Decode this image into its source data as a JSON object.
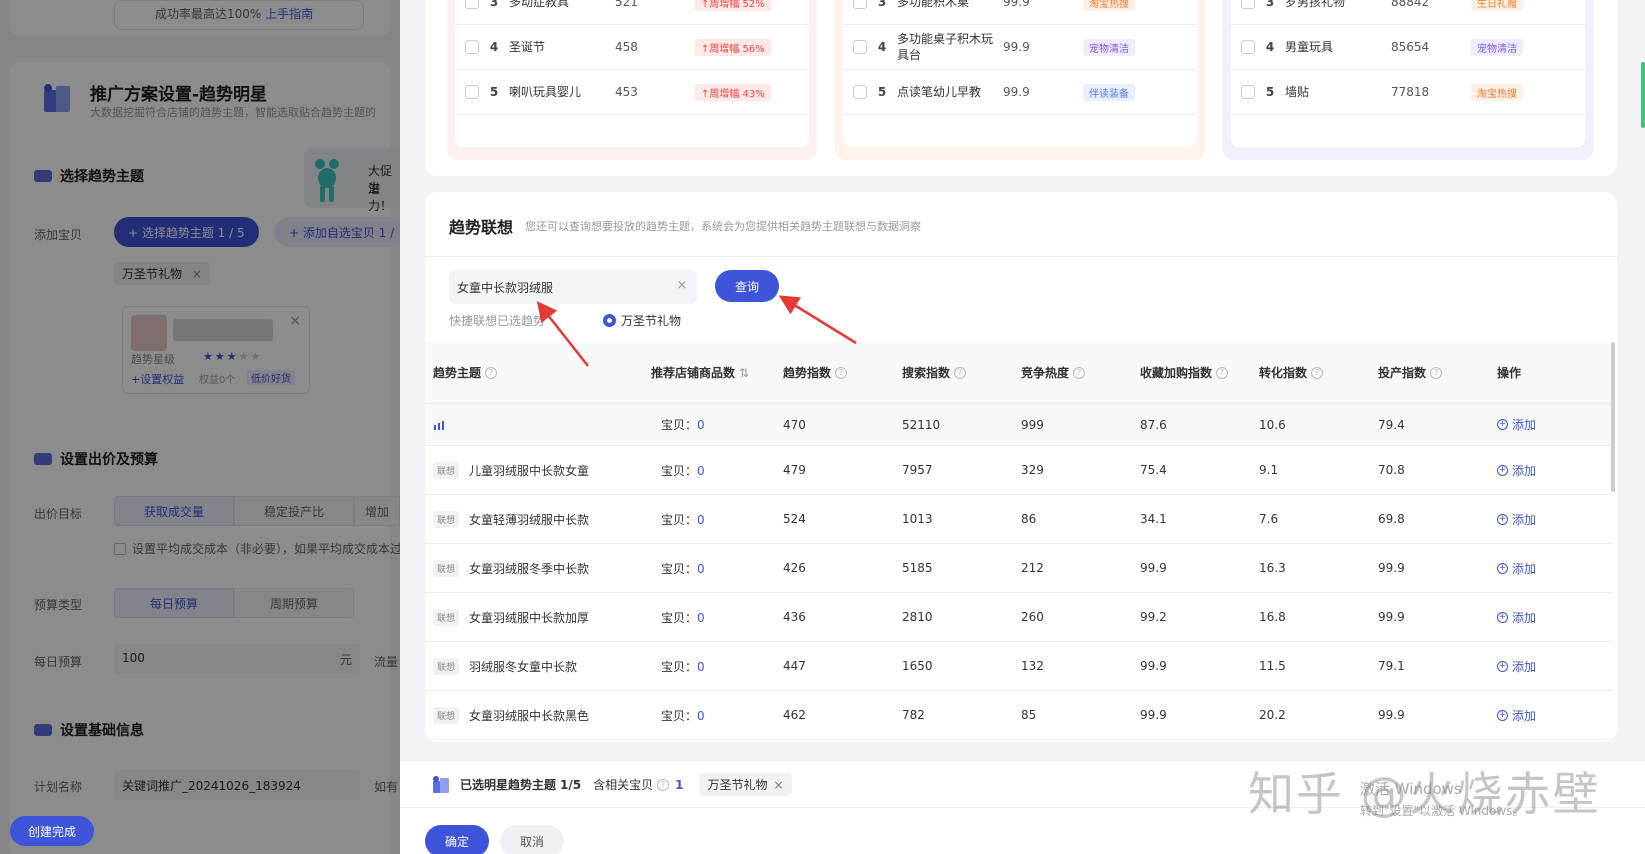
{
  "left_panel": {
    "top_hint": "成功率最高达100%",
    "top_hint_link": "上手指南",
    "title": "推广方案设置-趋势明星",
    "subtitle": "大数据挖掘符合店铺的趋势主题，智能选取贴合趋势主题的",
    "section_trend": "选择趋势主题",
    "promo_text_1": "大促生",
    "promo_text_2": "潜力！",
    "add_item_label": "添加宝贝",
    "select_trend_btn": "+ 选择趋势主题 1 / 5",
    "add_self_btn": "+ 添加自选宝贝 1 /",
    "selected_chip": "万圣节礼物",
    "item_star_label": "趋势星级",
    "item_set_rights": "+设置权益",
    "item_rights_text": "权益0个",
    "item_low_price": "低价好货",
    "section_bid": "设置出价及预算",
    "bid_target_label": "出价目标",
    "bid_opt_1": "获取成交量",
    "bid_opt_2": "稳定投产比",
    "bid_opt_3": "增加",
    "bid_checkbox_text": "设置平均成交成本（非必要），如果平均成交成本过",
    "budget_type_label": "预算类型",
    "budget_opt_1": "每日预算",
    "budget_opt_2": "周期预算",
    "daily_budget_label": "每日预算",
    "daily_budget_value": "100",
    "daily_budget_unit": "元",
    "flow_label": "流量",
    "section_basic": "设置基础信息",
    "plan_name_label": "计划名称",
    "plan_name_value": "关键词推广_20241026_183924",
    "plan_name_extra": "如有",
    "create_done": "创建完成"
  },
  "rank_lists": [
    {
      "rows": [
        {
          "no": "3",
          "name": "多动症教具",
          "value": "521",
          "tag": "↑周增幅 52%",
          "tag_color": "red"
        },
        {
          "no": "4",
          "name": "圣诞节",
          "value": "458",
          "tag": "↑周增幅 56%",
          "tag_color": "red"
        },
        {
          "no": "5",
          "name": "喇叭玩具婴儿",
          "value": "453",
          "tag": "↑周增幅 43%",
          "tag_color": "red"
        }
      ]
    },
    {
      "rows": [
        {
          "no": "3",
          "name": "多功能积木桌",
          "value": "99.9",
          "tag": "淘宝热搜",
          "tag_color": "orange"
        },
        {
          "no": "4",
          "name": "多功能桌子积木玩具台",
          "value": "99.9",
          "tag": "宠物清洁",
          "tag_color": "purple"
        },
        {
          "no": "5",
          "name": "点读笔幼儿早教",
          "value": "99.9",
          "tag": "伴读装备",
          "tag_color": "blue"
        }
      ]
    },
    {
      "rows": [
        {
          "no": "3",
          "name": "岁男孩礼物",
          "value": "88842",
          "tag": "生日礼赠",
          "tag_color": "orange"
        },
        {
          "no": "4",
          "name": "男童玩具",
          "value": "85654",
          "tag": "宠物清洁",
          "tag_color": "purple"
        },
        {
          "no": "5",
          "name": "墙贴",
          "value": "77818",
          "tag": "淘宝热搜",
          "tag_color": "orange"
        }
      ]
    }
  ],
  "assoc": {
    "title": "趋势联想",
    "desc": "您还可以查询想要投放的趋势主题，系统会为您提供相关趋势主题联想与数据洞察",
    "search_value": "女童中长款羽绒服",
    "clear": "×",
    "query_btn": "查询",
    "quick_label": "快捷联想已选趋势",
    "quick_option": "万圣节礼物"
  },
  "table": {
    "headers": [
      "趋势主题",
      "推荐店铺商品数",
      "趋势指数",
      "搜索指数",
      "竞争热度",
      "收藏加购指数",
      "转化指数",
      "投产指数",
      "操作"
    ],
    "sort_icon": "⇅",
    "goods_prefix": "宝贝：",
    "assoc_tag": "联想",
    "add_label": "添加",
    "rows": [
      {
        "theme": "",
        "goods": "0",
        "trend": "470",
        "search": "52110",
        "compete": "999",
        "fav": "87.6",
        "conv": "10.6",
        "roi": "79.4"
      },
      {
        "theme": "儿童羽绒服中长款女童",
        "goods": "0",
        "trend": "479",
        "search": "7957",
        "compete": "329",
        "fav": "75.4",
        "conv": "9.1",
        "roi": "70.8"
      },
      {
        "theme": "女童轻薄羽绒服中长款",
        "goods": "0",
        "trend": "524",
        "search": "1013",
        "compete": "86",
        "fav": "34.1",
        "conv": "7.6",
        "roi": "69.8"
      },
      {
        "theme": "女童羽绒服冬季中长款",
        "goods": "0",
        "trend": "426",
        "search": "5185",
        "compete": "212",
        "fav": "99.9",
        "conv": "16.3",
        "roi": "99.9"
      },
      {
        "theme": "女童羽绒服中长款加厚",
        "goods": "0",
        "trend": "436",
        "search": "2810",
        "compete": "260",
        "fav": "99.2",
        "conv": "16.8",
        "roi": "99.9"
      },
      {
        "theme": "羽绒服冬女童中长款",
        "goods": "0",
        "trend": "447",
        "search": "1650",
        "compete": "132",
        "fav": "99.9",
        "conv": "11.5",
        "roi": "79.1"
      },
      {
        "theme": "女童羽绒服中长款黑色",
        "goods": "0",
        "trend": "462",
        "search": "782",
        "compete": "85",
        "fav": "99.9",
        "conv": "20.2",
        "roi": "99.9"
      }
    ]
  },
  "footer": {
    "selected_label": "已选明星趋势主题",
    "selected_count": "1/5",
    "goods_label": "含相关宝贝",
    "goods_count": "1",
    "chip": "万圣节礼物",
    "ok": "确定",
    "cancel": "取消"
  },
  "overlay": {
    "watermark": "知乎 @火烧赤壁",
    "win_activate": "激活 Windows",
    "win_activate_sub": "转到\"设置\"以激活 Windows。"
  },
  "colors": {
    "primary": "#3f55d9",
    "tag_red": "#f0443f",
    "annotation_arrow": "#e53935"
  }
}
